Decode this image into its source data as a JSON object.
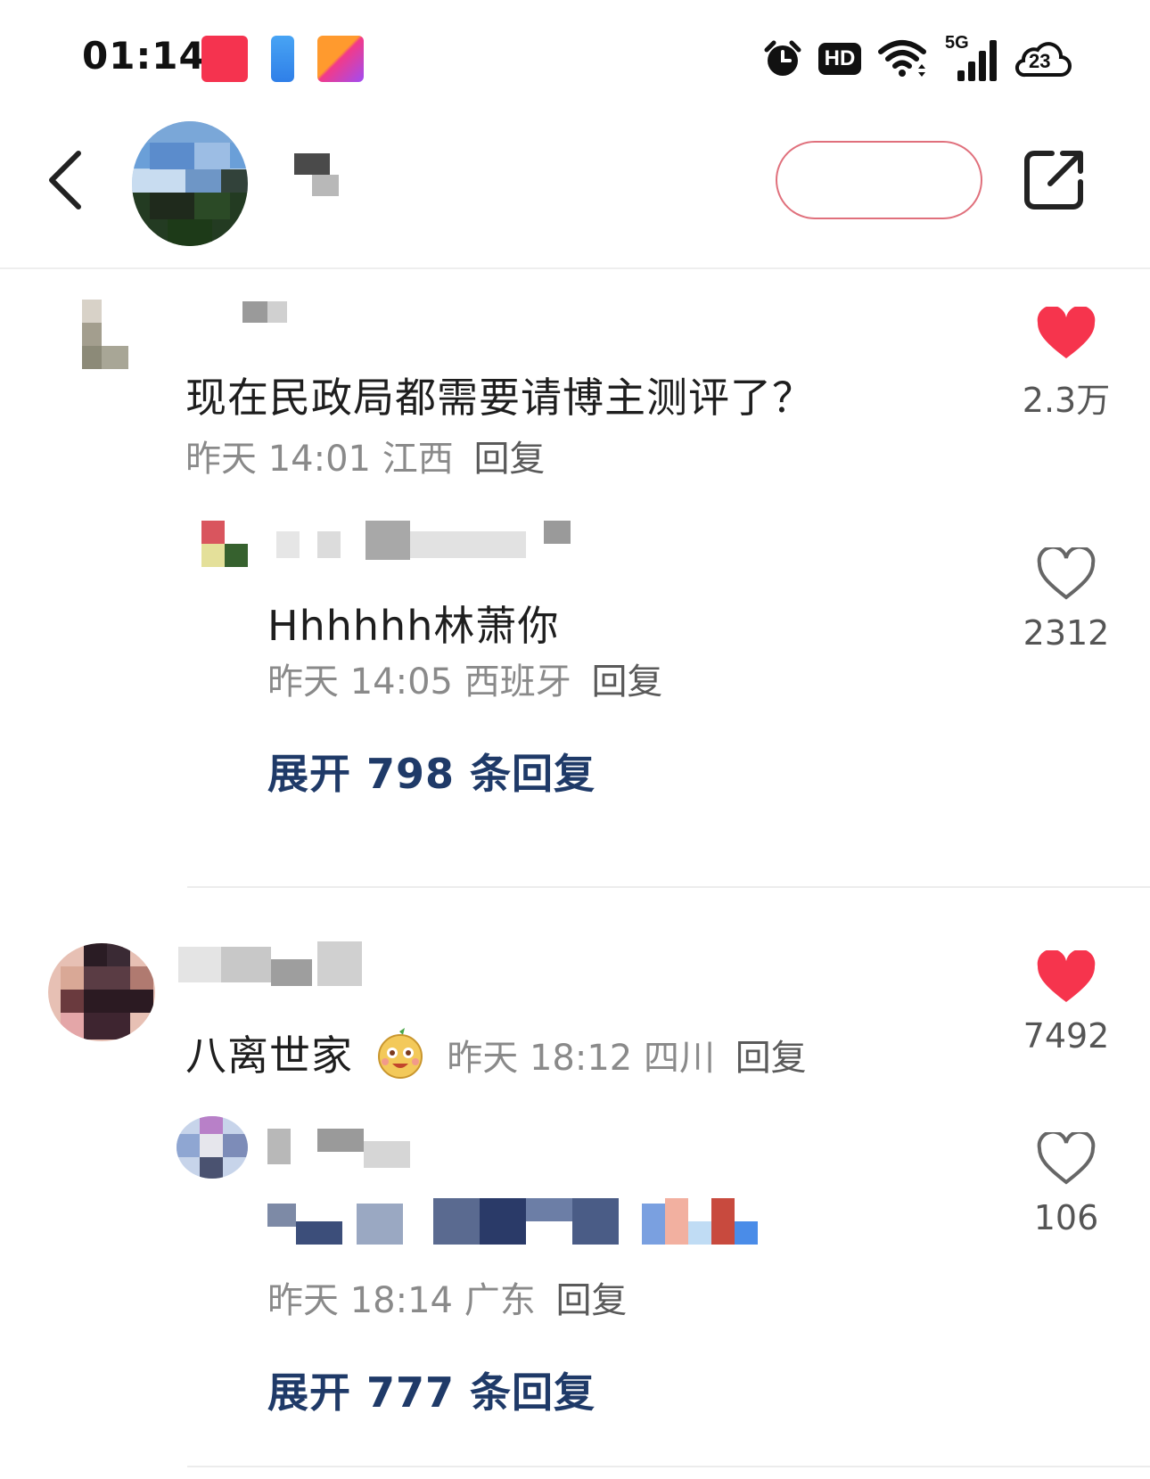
{
  "status_bar": {
    "time": "01:14",
    "network_label": "5G",
    "hd_label": "HD",
    "weather_temp": "23"
  },
  "comments": [
    {
      "text": "现在民政局都需要请博主测评了？",
      "date": "昨天 14:01",
      "location": "江西",
      "reply_label": "回复",
      "likes": "2.3万",
      "liked": true,
      "replies": [
        {
          "text": "Hhhhhh林萧你",
          "date": "昨天 14:05",
          "location": "西班牙",
          "reply_label": "回复",
          "likes": "2312",
          "liked": false
        }
      ],
      "expand_label": "展开 798 条回复"
    },
    {
      "text": "八离世家",
      "emoji": "smiling-face-emoji",
      "date": "昨天 18:12",
      "location": "四川",
      "reply_label": "回复",
      "likes": "7492",
      "liked": true,
      "replies": [
        {
          "text": "",
          "date": "昨天 18:14",
          "location": "广东",
          "reply_label": "回复",
          "likes": "106",
          "liked": false
        }
      ],
      "expand_label": "展开 777 条回复"
    }
  ],
  "colors": {
    "like_active": "#f6344d",
    "expand_link": "#1f3a68",
    "follow_border": "#e0707c"
  }
}
